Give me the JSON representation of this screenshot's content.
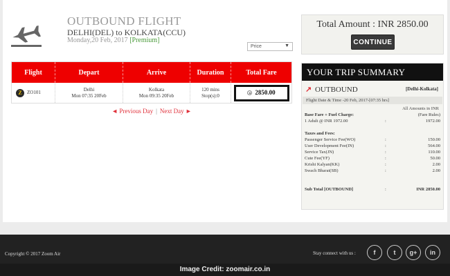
{
  "header": {
    "title": "OUTBOUND FLIGHT",
    "route": "DELHI(DEL) to KOLKATA(CCU)",
    "date": "Monday,20 Feb, 2017 ",
    "fare_class": "[Premium]"
  },
  "sort": {
    "selected": "Price"
  },
  "flights": {
    "columns": [
      "Flight",
      "Depart",
      "Arrive",
      "Duration",
      "Total Fare"
    ],
    "rows": [
      {
        "airline_logo": "Z",
        "flight_no": "ZO101",
        "depart_city": "Delhi",
        "depart_time": "Mon 07:35 20Feb",
        "arrive_city": "Kolkata",
        "arrive_time": "Mon 09:35 20Feb",
        "duration": "120 mins",
        "stops": "Stop(s):0",
        "fare": "2850.00"
      }
    ]
  },
  "day_nav": {
    "prev": "◄ Previous Day",
    "sep": "|",
    "next": "Next Day ►"
  },
  "total": {
    "label": "Total Amount :",
    "value": "INR 2850.00",
    "continue": "CONTINUE"
  },
  "summary": {
    "title": "YOUR TRIP SUMMARY",
    "outbound_label": "OUTBOUND",
    "outbound_route": "[Delhi-Kolkata]",
    "flight_datetime": "Flight Date & Time -20 Feb, 2017-[07:35 hrs]",
    "currency_note": "All Amounts in INR",
    "base_fare_label": "Base Fare + Fuel Charge:",
    "fare_rules": "(Fare Rules)",
    "adult_label": "1 Adult @ INR 1972.00",
    "adult_value": "1972.00",
    "taxes_label": "Taxes and Fees:",
    "taxes": [
      {
        "label": "Passenger Service Fee(WO)",
        "value": "150.00"
      },
      {
        "label": "User Development Fee(IN)",
        "value": "564.00"
      },
      {
        "label": "Service Tax(JN)",
        "value": "110.00"
      },
      {
        "label": "Cute Fee(YF)",
        "value": "50.00"
      },
      {
        "label": "Krishi Kalyan(KK)",
        "value": "2.00"
      },
      {
        "label": "Swach Bharat(SB)",
        "value": "2.00"
      }
    ],
    "subtotal_label": "Sub Total [OUTBOUND]",
    "subtotal_value": "INR 2850.00",
    "colon": ":"
  },
  "footer": {
    "copyright": "Copyright © 2017 Zoom Air",
    "stay_connected": "Stay connect with us :",
    "social": [
      "f",
      "t",
      "g+",
      "in"
    ]
  },
  "credit": "Image Credit: zoomair.co.in",
  "colors": {
    "accent_red": "#ee0000",
    "dark": "#111111",
    "footer": "#222222"
  }
}
